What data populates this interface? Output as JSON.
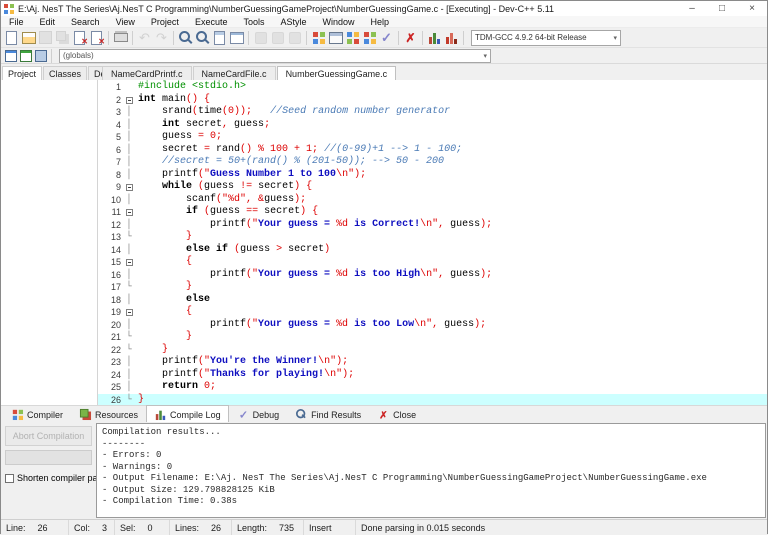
{
  "window": {
    "title": "E:\\Aj. NesT The Series\\Aj.NesT C Programming\\NumberGuessingGameProject\\NumberGuessingGame.c - [Executing] - Dev-C++ 5.11",
    "controls": {
      "minimize": "–",
      "maximize": "□",
      "close": "×"
    }
  },
  "menu": {
    "items": [
      "File",
      "Edit",
      "Search",
      "View",
      "Project",
      "Execute",
      "Tools",
      "AStyle",
      "Window",
      "Help"
    ]
  },
  "toolbar": {
    "compiler_select": "TDM-GCC 4.9.2 64-bit Release",
    "groups": [
      {
        "icons": [
          {
            "n": "new-file-icon",
            "k": "page",
            "d": false
          },
          {
            "n": "open-file-icon",
            "k": "open",
            "d": false
          },
          {
            "n": "save-icon",
            "k": "save",
            "d": true
          },
          {
            "n": "save-all-icon",
            "k": "saveall",
            "d": true
          },
          {
            "n": "close-file-icon",
            "k": "closef",
            "d": false
          },
          {
            "n": "close-all-icon",
            "k": "closef",
            "d": false
          }
        ]
      },
      {
        "icons": [
          {
            "n": "print-icon",
            "k": "print",
            "d": false
          }
        ]
      },
      {
        "icons": [
          {
            "n": "undo-icon",
            "k": "undo",
            "d": true
          },
          {
            "n": "redo-icon",
            "k": "redo",
            "d": true
          }
        ]
      },
      {
        "icons": [
          {
            "n": "find-icon",
            "k": "find",
            "d": false
          },
          {
            "n": "find-in-files-icon",
            "k": "find",
            "d": false
          },
          {
            "n": "replace-icon",
            "k": "goto",
            "d": false
          },
          {
            "n": "goto-line-icon",
            "k": "goto2",
            "d": false
          }
        ]
      },
      {
        "icons": [
          {
            "n": "back-icon",
            "k": "navd",
            "d": true
          },
          {
            "n": "forward-icon",
            "k": "navd",
            "d": true
          },
          {
            "n": "toggle-breakpoint-icon",
            "k": "navd",
            "d": true
          }
        ]
      },
      {
        "icons": [
          {
            "n": "compile-icon",
            "k": "grid4",
            "d": false
          },
          {
            "n": "run-icon",
            "k": "runwin",
            "d": false
          },
          {
            "n": "compile-run-icon",
            "k": "grid4b",
            "d": false
          },
          {
            "n": "rebuild-icon",
            "k": "grid4",
            "d": false
          },
          {
            "n": "syntax-check-icon",
            "k": "check",
            "d": false
          }
        ]
      },
      {
        "icons": [
          {
            "n": "abort-icon",
            "k": "xred",
            "d": false
          }
        ]
      },
      {
        "icons": [
          {
            "n": "profile-icon",
            "k": "chart",
            "d": false
          },
          {
            "n": "delete-profiling-icon",
            "k": "chartr",
            "d": false
          }
        ]
      }
    ]
  },
  "toolbar2": {
    "globals_select": "(globals)",
    "icons": [
      {
        "n": "new-project-icon",
        "k": "win1"
      },
      {
        "n": "add-to-project-icon",
        "k": "win2"
      },
      {
        "n": "remove-from-project-icon",
        "k": "win3"
      }
    ]
  },
  "left_tabs": [
    {
      "label": "Project",
      "active": true
    },
    {
      "label": "Classes",
      "active": false
    },
    {
      "label": "Debug",
      "active": false
    }
  ],
  "editor_tabs": [
    {
      "label": "NameCardPrintf.c",
      "active": false
    },
    {
      "label": "NameCardFile.c",
      "active": false
    },
    {
      "label": "NumberGuessingGame.c",
      "active": true
    }
  ],
  "editor": {
    "lines": [
      {
        "n": 1,
        "fold": "",
        "ind": 0,
        "tok": [
          [
            "p",
            "#include <stdio.h>"
          ]
        ]
      },
      {
        "n": 2,
        "fold": "box",
        "ind": 0,
        "tok": [
          [
            "k",
            "int"
          ],
          [
            "t",
            " main"
          ],
          [
            "r",
            "() {"
          ]
        ]
      },
      {
        "n": 3,
        "fold": "cont",
        "ind": 4,
        "tok": [
          [
            "t",
            "srand"
          ],
          [
            "r",
            "("
          ],
          [
            "t",
            "time"
          ],
          [
            "r",
            "(0));"
          ],
          [
            "t",
            "   "
          ],
          [
            "c",
            "//Seed random number generator"
          ]
        ]
      },
      {
        "n": 4,
        "fold": "cont",
        "ind": 4,
        "tok": [
          [
            "k",
            "int"
          ],
          [
            "t",
            " secret"
          ],
          [
            "r",
            ","
          ],
          [
            "t",
            " guess"
          ],
          [
            "r",
            ";"
          ]
        ]
      },
      {
        "n": 5,
        "fold": "cont",
        "ind": 4,
        "tok": [
          [
            "t",
            "guess "
          ],
          [
            "r",
            "= 0;"
          ]
        ]
      },
      {
        "n": 6,
        "fold": "cont",
        "ind": 4,
        "tok": [
          [
            "t",
            "secret "
          ],
          [
            "r",
            "="
          ],
          [
            "t",
            " rand"
          ],
          [
            "r",
            "() % 100 + 1;"
          ],
          [
            "t",
            " "
          ],
          [
            "c",
            "//(0-99)+1 --> 1 - 100;"
          ]
        ]
      },
      {
        "n": 7,
        "fold": "cont",
        "ind": 4,
        "tok": [
          [
            "c",
            "//secret = 50+(rand() % (201-50)); --> 50 - 200"
          ]
        ]
      },
      {
        "n": 8,
        "fold": "cont",
        "ind": 4,
        "tok": [
          [
            "t",
            "printf"
          ],
          [
            "r",
            "(\""
          ],
          [
            "s",
            "Guess Number 1 to 100"
          ],
          [
            "r",
            "\\n\");"
          ]
        ]
      },
      {
        "n": 9,
        "fold": "box",
        "ind": 4,
        "tok": [
          [
            "k",
            "while"
          ],
          [
            "t",
            " "
          ],
          [
            "r",
            "("
          ],
          [
            "t",
            "guess "
          ],
          [
            "r",
            "!="
          ],
          [
            "t",
            " secret"
          ],
          [
            "r",
            ") {"
          ]
        ]
      },
      {
        "n": 10,
        "fold": "cont",
        "ind": 8,
        "tok": [
          [
            "t",
            "scanf"
          ],
          [
            "r",
            "(\"%d\","
          ],
          [
            "t",
            " "
          ],
          [
            "r",
            "&"
          ],
          [
            "t",
            "guess"
          ],
          [
            "r",
            ");"
          ]
        ]
      },
      {
        "n": 11,
        "fold": "box",
        "ind": 8,
        "tok": [
          [
            "k",
            "if"
          ],
          [
            "t",
            " "
          ],
          [
            "r",
            "("
          ],
          [
            "t",
            "guess "
          ],
          [
            "r",
            "=="
          ],
          [
            "t",
            " secret"
          ],
          [
            "r",
            ") {"
          ]
        ]
      },
      {
        "n": 12,
        "fold": "cont",
        "ind": 12,
        "tok": [
          [
            "t",
            "printf"
          ],
          [
            "r",
            "(\""
          ],
          [
            "s",
            "Your guess = "
          ],
          [
            "r",
            "%d"
          ],
          [
            "s",
            " is Correct!"
          ],
          [
            "r",
            "\\n\","
          ],
          [
            "t",
            " guess"
          ],
          [
            "r",
            ");"
          ]
        ]
      },
      {
        "n": 13,
        "fold": "end",
        "ind": 8,
        "tok": [
          [
            "r",
            "}"
          ]
        ]
      },
      {
        "n": 14,
        "fold": "cont",
        "ind": 8,
        "tok": [
          [
            "k",
            "else"
          ],
          [
            "t",
            " "
          ],
          [
            "k",
            "if"
          ],
          [
            "t",
            " "
          ],
          [
            "r",
            "("
          ],
          [
            "t",
            "guess "
          ],
          [
            "r",
            ">"
          ],
          [
            "t",
            " secret"
          ],
          [
            "r",
            ")"
          ]
        ]
      },
      {
        "n": 15,
        "fold": "box",
        "ind": 8,
        "tok": [
          [
            "r",
            "{"
          ]
        ]
      },
      {
        "n": 16,
        "fold": "cont",
        "ind": 12,
        "tok": [
          [
            "t",
            "printf"
          ],
          [
            "r",
            "(\""
          ],
          [
            "s",
            "Your guess = "
          ],
          [
            "r",
            "%d"
          ],
          [
            "s",
            " is too High"
          ],
          [
            "r",
            "\\n\","
          ],
          [
            "t",
            " guess"
          ],
          [
            "r",
            ");"
          ]
        ]
      },
      {
        "n": 17,
        "fold": "end",
        "ind": 8,
        "tok": [
          [
            "r",
            "}"
          ]
        ]
      },
      {
        "n": 18,
        "fold": "cont",
        "ind": 8,
        "tok": [
          [
            "k",
            "else"
          ]
        ]
      },
      {
        "n": 19,
        "fold": "box",
        "ind": 8,
        "tok": [
          [
            "r",
            "{"
          ]
        ]
      },
      {
        "n": 20,
        "fold": "cont",
        "ind": 12,
        "tok": [
          [
            "t",
            "printf"
          ],
          [
            "r",
            "(\""
          ],
          [
            "s",
            "Your guess = "
          ],
          [
            "r",
            "%d"
          ],
          [
            "s",
            " is too Low"
          ],
          [
            "r",
            "\\n\","
          ],
          [
            "t",
            " guess"
          ],
          [
            "r",
            ");"
          ]
        ]
      },
      {
        "n": 21,
        "fold": "end",
        "ind": 8,
        "tok": [
          [
            "r",
            "}"
          ]
        ]
      },
      {
        "n": 22,
        "fold": "end",
        "ind": 4,
        "tok": [
          [
            "r",
            "}"
          ]
        ]
      },
      {
        "n": 23,
        "fold": "cont",
        "ind": 4,
        "tok": [
          [
            "t",
            "printf"
          ],
          [
            "r",
            "(\""
          ],
          [
            "s",
            "You're the Winner!"
          ],
          [
            "r",
            "\\n\");"
          ]
        ]
      },
      {
        "n": 24,
        "fold": "cont",
        "ind": 4,
        "tok": [
          [
            "t",
            "printf"
          ],
          [
            "r",
            "(\""
          ],
          [
            "s",
            "Thanks for playing!"
          ],
          [
            "r",
            "\\n\");"
          ]
        ]
      },
      {
        "n": 25,
        "fold": "cont",
        "ind": 4,
        "tok": [
          [
            "k",
            "return"
          ],
          [
            "t",
            " "
          ],
          [
            "r",
            "0;"
          ]
        ]
      },
      {
        "n": 26,
        "fold": "end",
        "ind": 0,
        "hl": true,
        "tok": [
          [
            "r",
            "}"
          ]
        ]
      }
    ]
  },
  "bottom_tabs": [
    {
      "label": "Compiler",
      "icon": "grid4",
      "active": false
    },
    {
      "label": "Resources",
      "icon": "res",
      "active": false
    },
    {
      "label": "Compile Log",
      "icon": "chart",
      "active": true
    },
    {
      "label": "Debug",
      "icon": "check",
      "active": false
    },
    {
      "label": "Find Results",
      "icon": "find",
      "active": false
    },
    {
      "label": "Close",
      "icon": "xred",
      "active": false
    }
  ],
  "compile_panel": {
    "abort_button": "Abort Compilation",
    "shorten_checkbox": "Shorten compiler paths",
    "log": [
      "Compilation results...",
      "--------",
      "- Errors: 0",
      "- Warnings: 0",
      "- Output Filename: E:\\Aj. NesT The Series\\Aj.NesT C Programming\\NumberGuessingGameProject\\NumberGuessingGame.exe",
      "- Output Size: 129.798828125 KiB",
      "- Compilation Time: 0.38s"
    ]
  },
  "status_bar": {
    "segments": [
      {
        "k": "line",
        "l": "Line:",
        "v": "26"
      },
      {
        "k": "col",
        "l": "Col:",
        "v": "3"
      },
      {
        "k": "sel",
        "l": "Sel:",
        "v": "0"
      },
      {
        "k": "lines",
        "l": "Lines:",
        "v": "26"
      },
      {
        "k": "length",
        "l": "Length:",
        "v": "735"
      },
      {
        "k": "mode",
        "l": "Insert",
        "v": ""
      },
      {
        "k": "message",
        "l": "Done parsing in 0.015 seconds",
        "v": ""
      }
    ]
  }
}
